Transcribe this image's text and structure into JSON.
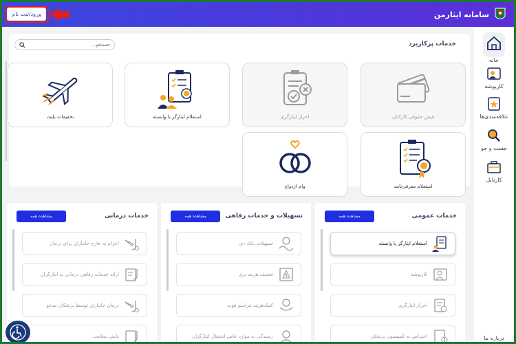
{
  "header": {
    "app_title": "سامانه ایثارمن",
    "login_label": "ورود/ثبت نام"
  },
  "sidebar": {
    "items": [
      {
        "label": "خانه",
        "icon": "home-icon"
      },
      {
        "label": "کارپوشه",
        "icon": "folder-user-icon"
      },
      {
        "label": "علاقه‌مندی‌ها",
        "icon": "star-icon"
      },
      {
        "label": "جست و جو",
        "icon": "search-icon"
      },
      {
        "label": "کارتابل",
        "icon": "cartable-icon"
      }
    ],
    "partial_label": "درباره ما"
  },
  "services": {
    "title": "خدمات پرکاربرد",
    "search_placeholder": "جستجو...",
    "cards": [
      {
        "label": "فیش حقوقی کارکنان",
        "icon": "payslip-card-icon"
      },
      {
        "label": "احراز ایثارگری",
        "icon": "clipboard-reject-icon"
      },
      {
        "label": "استعلام ایثارگر یا وابسته",
        "icon": "inquiry-people-icon"
      },
      {
        "label": "تخفیفات بلیت",
        "icon": "airplane-icon"
      },
      {
        "label": "استعلام معرفی‌نامه",
        "icon": "certificate-clipboard-icon"
      },
      {
        "label": "وام ازدواج",
        "icon": "rings-icon"
      }
    ]
  },
  "columns": [
    {
      "title": "خدمات عمومی",
      "view_all": "مشاهده همه",
      "items": [
        {
          "label": "استعلام ایثارگر یا وابسته"
        },
        {
          "label": "کارپوشه"
        },
        {
          "label": "احراز ایثارگری"
        },
        {
          "label": "اعتراض به کمیسیون پزشکی"
        }
      ]
    },
    {
      "title": "تسهیلات و خدمات رفاهی",
      "view_all": "مشاهده همه",
      "items": [
        {
          "label": "تسهیلات بانک دی"
        },
        {
          "label": "تخفیف هزینه برق"
        },
        {
          "label": "کمک‌هزینه مراسم فوت"
        },
        {
          "label": "رسیدگی به موارد خاص اشتغال ایثارگران"
        }
      ]
    },
    {
      "title": "خدمات درمانی",
      "view_all": "مشاهده همه",
      "items": [
        {
          "label": "اعزام به خارج جانبازان برای درمان"
        },
        {
          "label": "ارائه خدمات رفاهی درمانی به ایثارگران"
        },
        {
          "label": "درمان جانبازان توسط پزشکان مدعو"
        },
        {
          "label": "پایش سلامت"
        }
      ]
    }
  ],
  "colors": {
    "header_gradient_start": "#3b47e0",
    "header_gradient_end": "#5a2fd6",
    "button_blue": "#1e2ee0",
    "icon_navy": "#1a2a5e",
    "icon_orange": "#f5a623",
    "outer_border": "#1a7a32",
    "highlight_red": "#e02020"
  }
}
